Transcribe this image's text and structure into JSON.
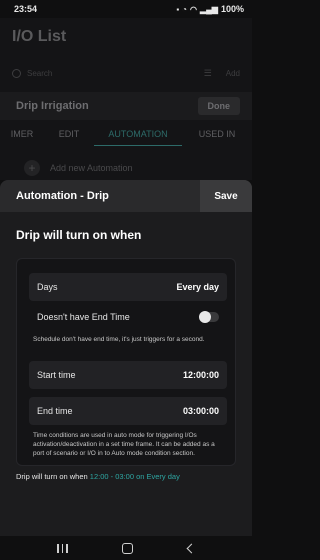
{
  "status_bar": {
    "time": "23:54",
    "battery": "100%"
  },
  "background": {
    "page_title": "I/O List",
    "search_placeholder": "Search",
    "add_label": "Add",
    "item_title": "Drip Irrigation",
    "done_label": "Done",
    "tabs": [
      "IMER",
      "EDIT",
      "AUTOMATION",
      "USED IN"
    ],
    "active_tab": "AUTOMATION",
    "add_automation_label": "Add new Automation"
  },
  "sheet": {
    "title": "Automation - Drip",
    "save_label": "Save",
    "heading": "Drip will turn on when",
    "days_label": "Days",
    "days_value": "Every day",
    "no_end_label": "Doesn't have End Time",
    "no_end_enabled": false,
    "no_end_note": "Schedule don't have end time, it's just triggers for a second.",
    "start_label": "Start time",
    "start_value": "12:00:00",
    "end_label": "End time",
    "end_value": "03:00:00",
    "info_note": "Time conditions are used in auto mode for triggering I/Os activation/deactivation in a set time frame. It can be added as a port of scenario or I/O in to Auto mode condition section.",
    "summary_prefix": "Drip will turn on when",
    "summary_value": "12:00 - 03:00 on Every day"
  },
  "colors": {
    "accent": "#2ea6a2",
    "sheet_bg": "#1c1c1e"
  }
}
